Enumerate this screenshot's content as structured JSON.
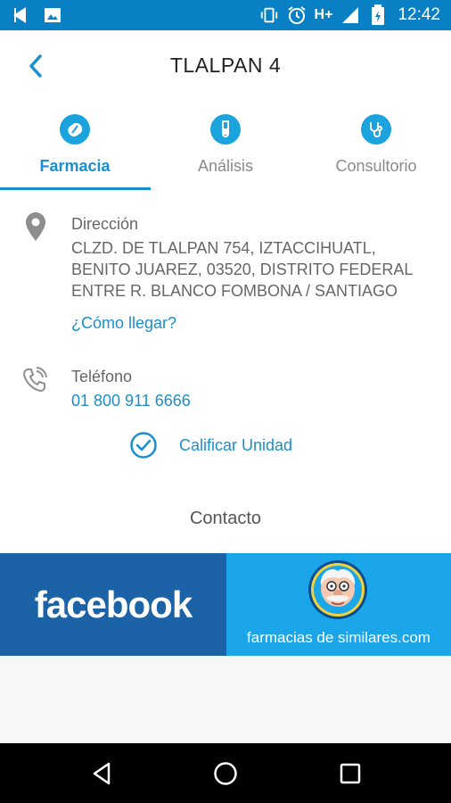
{
  "status_bar": {
    "network": "H+",
    "time": "12:42"
  },
  "header": {
    "title": "TLALPAN 4"
  },
  "tabs": [
    {
      "label": "Farmacia",
      "icon": "pharmacy-icon",
      "active": true
    },
    {
      "label": "Análisis",
      "icon": "test-tube-icon",
      "active": false
    },
    {
      "label": "Consultorio",
      "icon": "stethoscope-icon",
      "active": false
    }
  ],
  "address": {
    "label": "Dirección",
    "lines": [
      "CLZD. DE TLALPAN 754, IZTACCIHUATL,",
      "BENITO JUAREZ, 03520, DISTRITO FEDERAL",
      "ENTRE R. BLANCO FOMBONA / SANTIAGO"
    ],
    "directions_link": "¿Cómo llegar?"
  },
  "phone": {
    "label": "Teléfono",
    "number": "01 800 911 6666"
  },
  "rate": {
    "label": "Calificar Unidad"
  },
  "contact": {
    "label": "Contacto"
  },
  "banner": {
    "facebook": "facebook",
    "similares": "farmacias de similares.com"
  },
  "colors": {
    "accent": "#1a8fd0",
    "status_bar": "#0a80c4",
    "facebook": "#1b62a6",
    "similares": "#1aa6e8"
  }
}
